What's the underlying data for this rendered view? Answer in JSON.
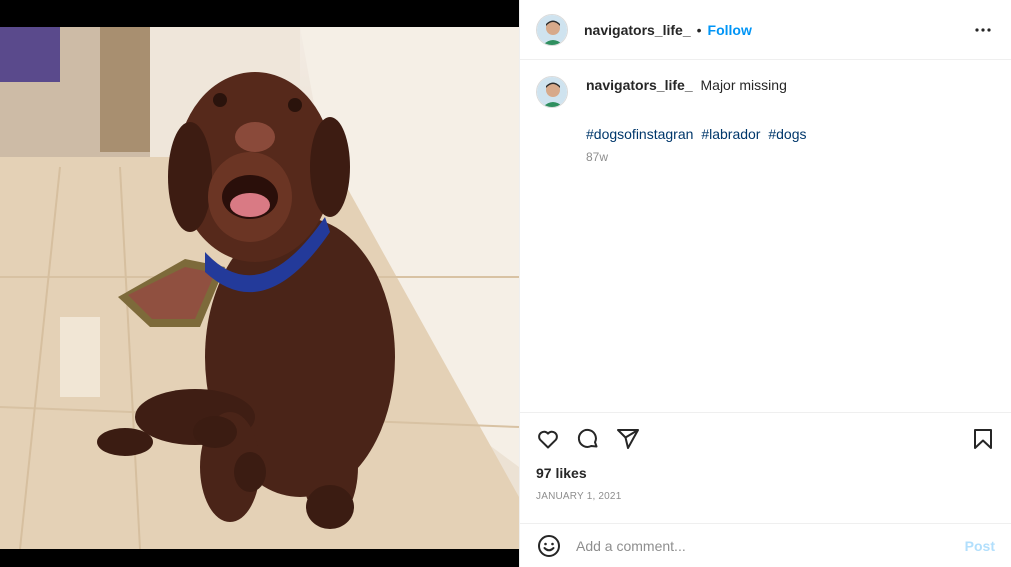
{
  "post": {
    "username": "navigators_life_",
    "separator": "•",
    "follow_label": "Follow",
    "image_alt": "Chocolate labrador sitting on a wooden floor against a wall"
  },
  "caption": {
    "username": "navigators_life_",
    "text": "Major missing",
    "hashtags": [
      "#dogsofinstagran",
      "#labrador",
      "#dogs"
    ],
    "age": "87w"
  },
  "stats": {
    "likes": "97 likes",
    "date": "JANUARY 1, 2021"
  },
  "comment": {
    "placeholder": "Add a comment...",
    "post_label": "Post"
  },
  "icons": {
    "more": "more-options-icon",
    "like": "heart-icon",
    "comment": "comment-icon",
    "share": "share-icon",
    "save": "bookmark-icon",
    "emoji": "emoji-icon"
  },
  "colors": {
    "follow": "#0095f6",
    "hashtag": "#00376b",
    "muted": "#8e8e8e",
    "post_disabled": "#b2dffc"
  }
}
